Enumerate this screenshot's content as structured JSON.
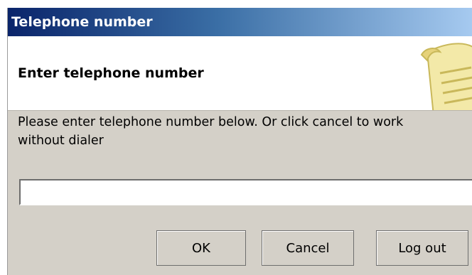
{
  "window": {
    "title": "Telephone number"
  },
  "header": {
    "title": "Enter telephone number",
    "icon": "scroll-icon"
  },
  "instructions": "Please enter telephone number below. Or click cancel to work without dialer",
  "phone_input": {
    "value": "",
    "placeholder": ""
  },
  "buttons": {
    "ok": "OK",
    "cancel": "Cancel",
    "logout": "Log out"
  }
}
